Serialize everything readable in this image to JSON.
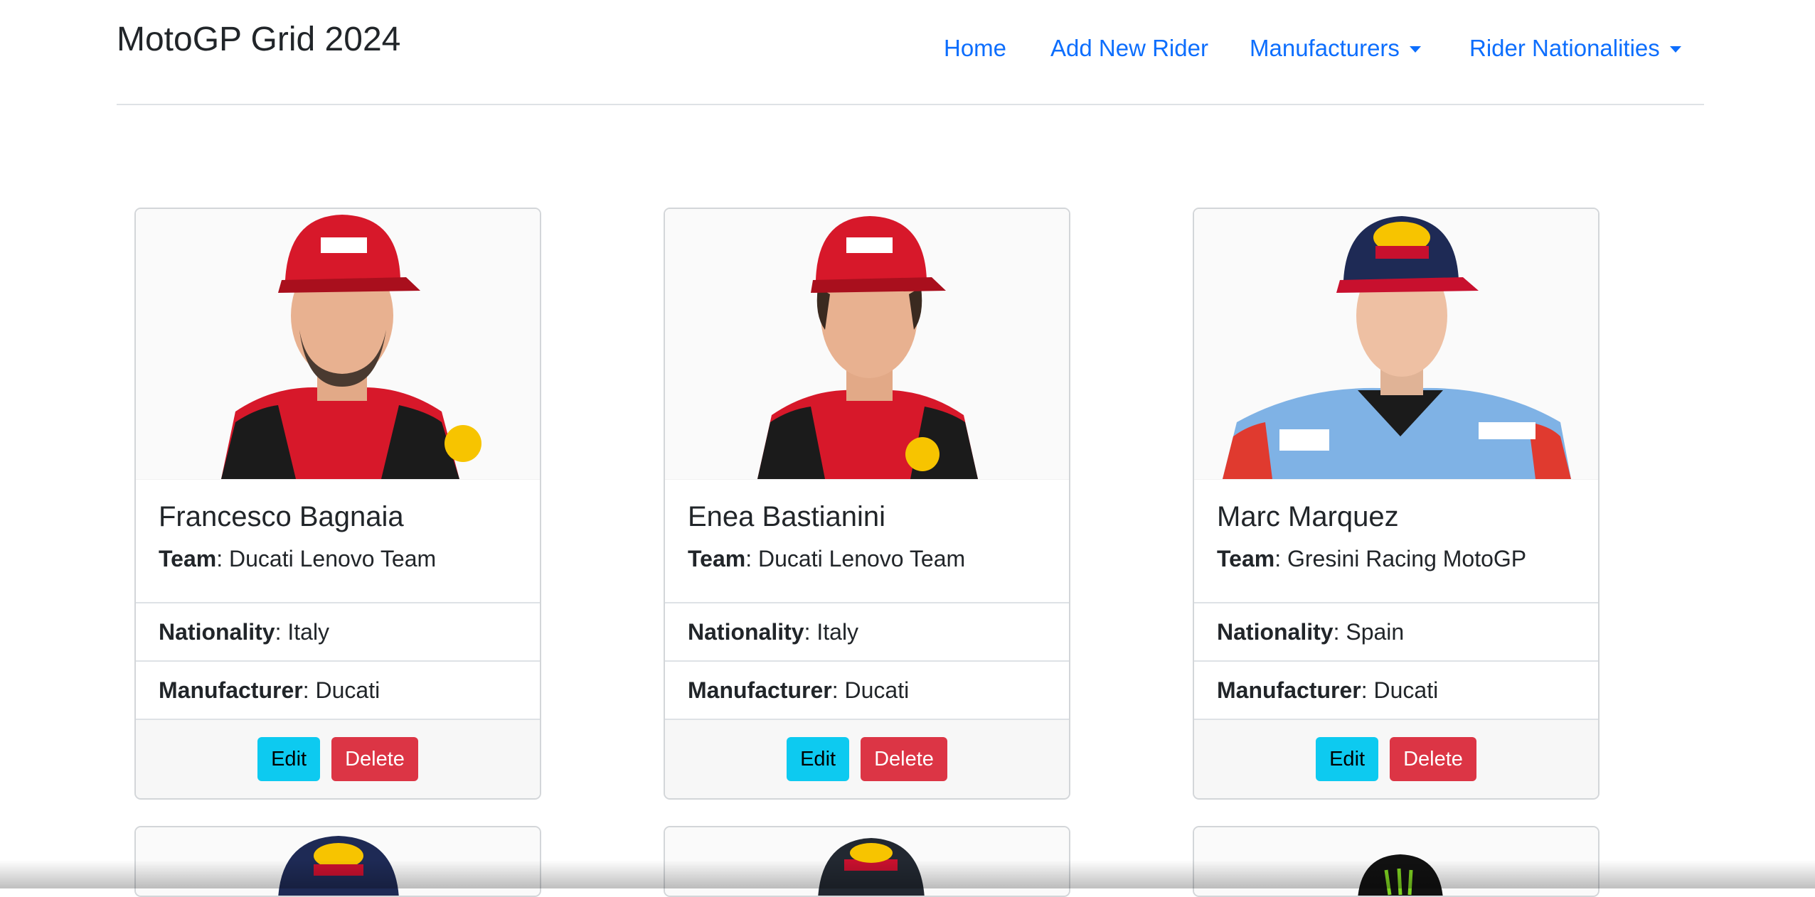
{
  "brand": "MotoGP Grid 2024",
  "nav": {
    "home": "Home",
    "add_rider": "Add New Rider",
    "manufacturers": "Manufacturers",
    "nationalities": "Rider Nationalities"
  },
  "labels": {
    "team": "Team",
    "nationality": "Nationality",
    "manufacturer": "Manufacturer",
    "edit": "Edit",
    "delete": "Delete"
  },
  "riders": [
    {
      "name": "Francesco Bagnaia",
      "team": "Ducati Lenovo Team",
      "nationality": "Italy",
      "manufacturer": "Ducati"
    },
    {
      "name": "Enea Bastianini",
      "team": "Ducati Lenovo Team",
      "nationality": "Italy",
      "manufacturer": "Ducati"
    },
    {
      "name": "Marc Marquez",
      "team": "Gresini Racing MotoGP",
      "nationality": "Spain",
      "manufacturer": "Ducati"
    }
  ],
  "colors": {
    "link": "#0d6efd",
    "edit_button": "#0dcaf0",
    "delete_button": "#dc3545",
    "ducati_red": "#d7182a",
    "gresini_blue": "#7fb2e5",
    "redbull_navy": "#1e2a55",
    "monster_black": "#111111"
  }
}
